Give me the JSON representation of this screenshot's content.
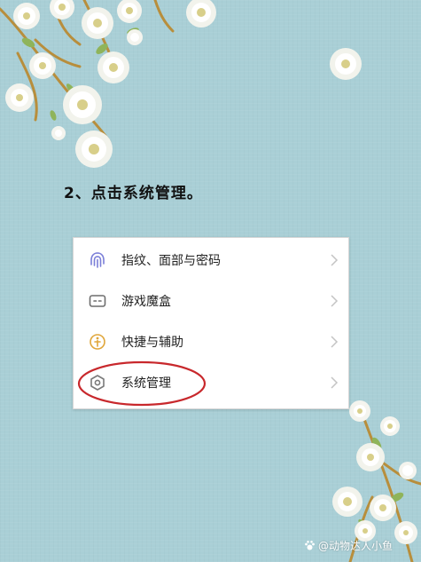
{
  "instruction": {
    "text": "2、点击系统管理。"
  },
  "settings_menu": {
    "items": [
      {
        "label": "指纹、面部与密码",
        "icon": "fingerprint-icon"
      },
      {
        "label": "游戏魔盒",
        "icon": "game-box-icon"
      },
      {
        "label": "快捷与辅助",
        "icon": "shortcut-assist-icon"
      },
      {
        "label": "系统管理",
        "icon": "system-settings-icon"
      }
    ]
  },
  "highlight": {
    "target": "系统管理",
    "color": "#c8282c"
  },
  "watermark": {
    "text": "@动物达人小鱼"
  },
  "colors": {
    "background": "#a9cfd6",
    "fingerprint_icon": "#7b7fd8",
    "game_icon": "#6d6d6d",
    "assist_icon": "#e0a63a",
    "system_icon": "#7a7a7a"
  }
}
